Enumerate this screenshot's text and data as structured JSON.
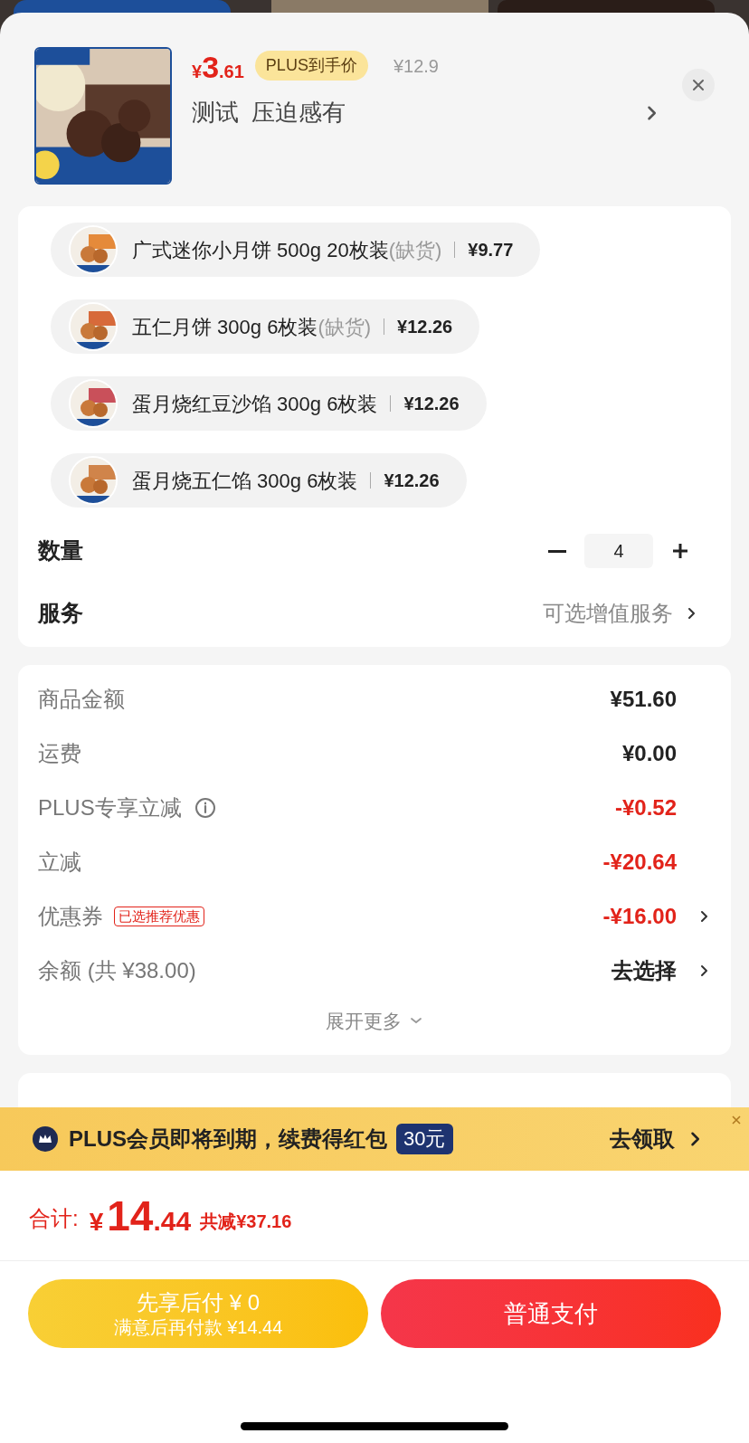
{
  "header": {
    "price_symbol": "¥",
    "price_integer": "3",
    "price_decimal": ".61",
    "badge": "PLUS到手价",
    "original_price": "¥12.9",
    "title": "测试  压迫感有"
  },
  "variants": [
    {
      "name": "广式迷你小月饼 500g 20枚装",
      "stock_note": "(缺货)",
      "price": "¥9.77"
    },
    {
      "name": "五仁月饼 300g 6枚装",
      "stock_note": "(缺货)",
      "price": "¥12.26"
    },
    {
      "name": "蛋月烧红豆沙馅 300g 6枚装",
      "price": "¥12.26"
    },
    {
      "name": "蛋月烧五仁馅 300g 6枚装",
      "price": "¥12.26"
    }
  ],
  "quantity": {
    "label": "数量",
    "value": "4"
  },
  "service": {
    "label": "服务",
    "value": "可选增值服务"
  },
  "fees": [
    {
      "kind": "plain",
      "label": "商品金额",
      "value": "¥51.60",
      "discount": false,
      "arrow": false
    },
    {
      "kind": "plain",
      "label": "运费",
      "value": "¥0.00",
      "discount": false,
      "arrow": false
    },
    {
      "kind": "info",
      "label": "PLUS专享立减",
      "value": "-¥0.52",
      "discount": true,
      "arrow": false
    },
    {
      "kind": "plain",
      "label": "立减",
      "value": "-¥20.64",
      "discount": true,
      "arrow": false
    },
    {
      "kind": "tag",
      "label": "优惠券",
      "tag": "已选推荐优惠",
      "value": "-¥16.00",
      "discount": true,
      "arrow": true
    },
    {
      "kind": "plain",
      "label": "余额 (共 ¥38.00)",
      "value": "去选择",
      "discount": false,
      "arrow": true
    }
  ],
  "expand": "展开更多",
  "banner": {
    "text": "PLUS会员即将到期，续费得红包",
    "badge": "30元",
    "action": "去领取"
  },
  "total": {
    "label": "合计:",
    "symbol": "¥",
    "integer": "14",
    "decimal": ".44",
    "saved": "共减¥37.16"
  },
  "buttons": {
    "later": {
      "title": "先享后付 ¥ 0",
      "subtitle": "满意后再付款 ¥14.44"
    },
    "pay": "普通支付"
  }
}
